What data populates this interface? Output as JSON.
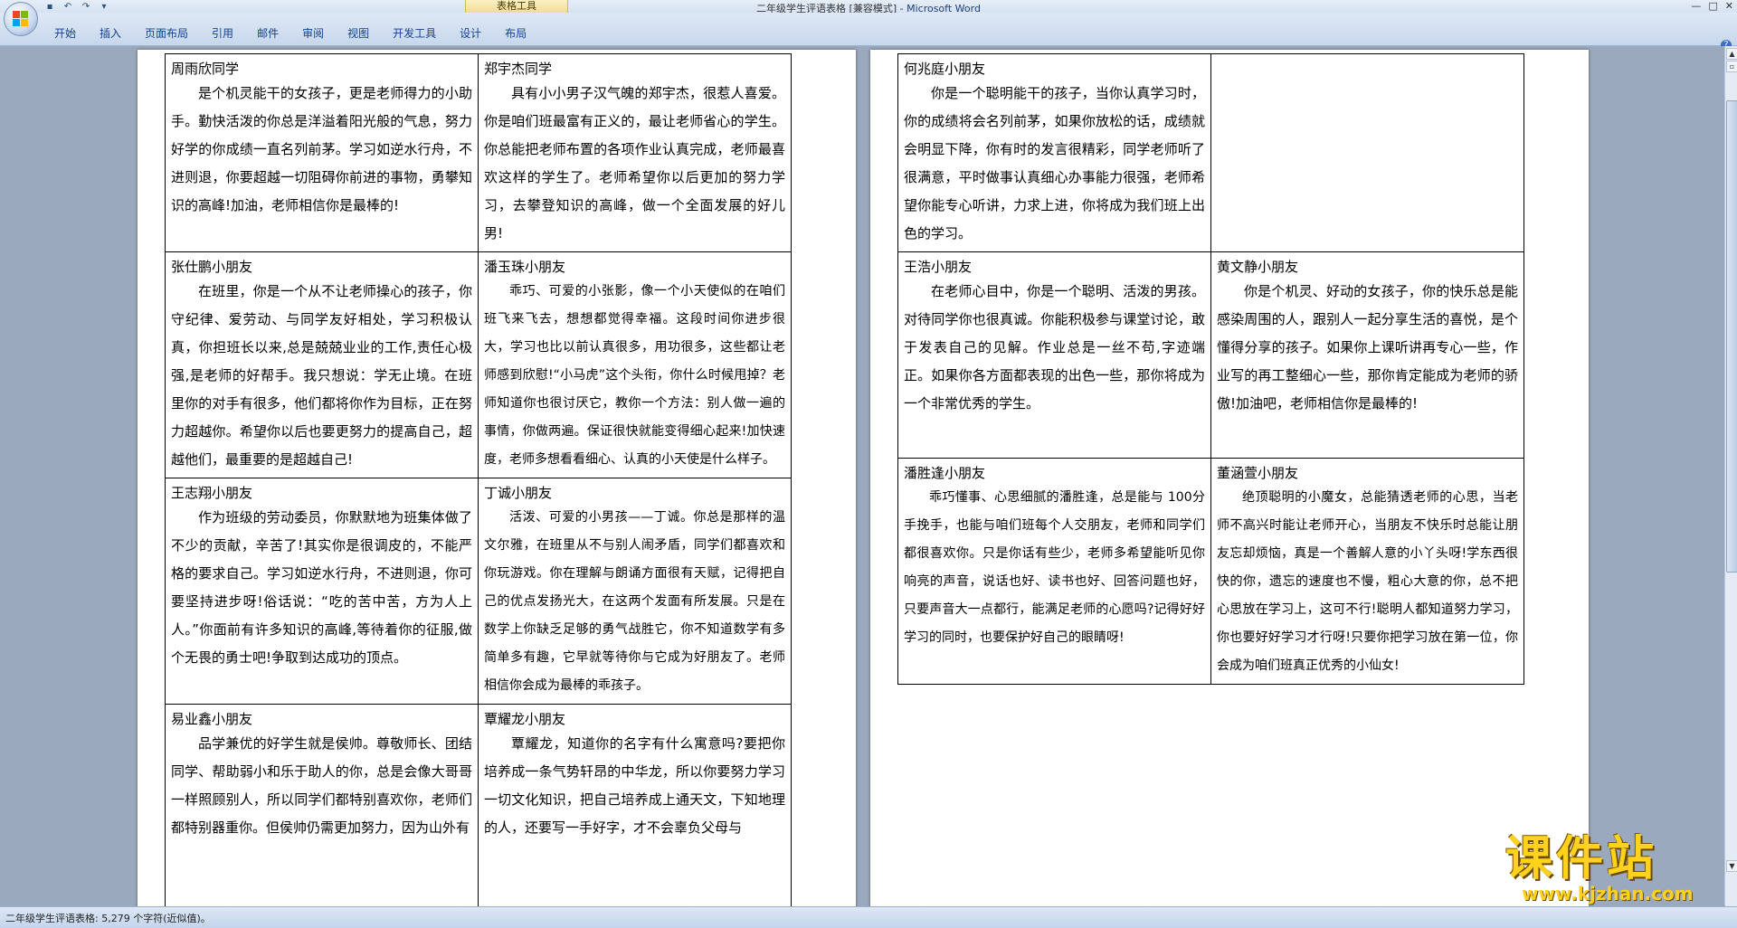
{
  "window": {
    "title": "二年级学生评语表格 [兼容模式] - ",
    "app_name": "Microsoft Word",
    "context_tab": "表格工具",
    "controls": [
      "—",
      "□",
      "✕"
    ]
  },
  "ribbon": {
    "tabs": [
      "开始",
      "插入",
      "页面布局",
      "引用",
      "邮件",
      "审阅",
      "视图",
      "开发工具",
      "设计",
      "布局"
    ],
    "help": "?"
  },
  "pages": [
    {
      "rows": [
        [
          {
            "name": "周雨欣同学",
            "text": "是个机灵能干的女孩子，更是老师得力的小助手。勤快活泼的你总是洋溢着阳光般的气息，努力好学的你成绩一直名列前茅。学习如逆水行舟，不进则退，你要超越一切阻碍你前进的事物，勇攀知识的高峰!加油，老师相信你是最棒的!"
          },
          {
            "name": "郑宇杰同学",
            "text": "具有小小男子汉气魄的郑宇杰，很惹人喜爱。你是咱们班最富有正义的，最让老师省心的学生。你总能把老师布置的各项作业认真完成，老师最喜欢这样的学生了。老师希望你以后更加的努力学习，去攀登知识的高峰，做一个全面发展的好儿男!"
          }
        ],
        [
          {
            "name": "张仕鹏小朋友",
            "text": "在班里，你是一个从不让老师操心的孩子，你守纪律、爱劳动、与同学友好相处，学习积极认真，你担班长以来,总是兢兢业业的工作,责任心极强,是老师的好帮手。我只想说：学无止境。在班里你的对手有很多，他们都将你作为目标，正在努力超越你。希望你以后也要更努力的提高自己，超越他们，最重要的是超越自己!"
          },
          {
            "name": "潘玉珠小朋友",
            "text": "乖巧、可爱的小张影，像一个小天使似的在咱们班飞来飞去，想想都觉得幸福。这段时间你进步很大，学习也比以前认真很多，用功很多，这些都让老师感到欣慰!“小马虎”这个头衔，你什么时候甩掉？老师知道你也很讨厌它，教你一个方法：别人做一遍的事情，你做两遍。保证很快就能变得细心起来!加快速度，老师多想看看细心、认真的小天使是什么样子。"
          }
        ],
        [
          {
            "name": "王志翔小朋友",
            "text": "作为班级的劳动委员，你默默地为班集体做了不少的贡献，辛苦了!其实你是很调皮的，不能严格的要求自己。学习如逆水行舟，不进则退，你可要坚持进步呀!俗话说：“吃的苦中苦，方为人上人。”你面前有许多知识的高峰,等待着你的征服,做个无畏的勇士吧!争取到达成功的顶点。"
          },
          {
            "name": "丁诚小朋友",
            "text": "活泼、可爱的小男孩——丁诚。你总是那样的温文尔雅，在班里从不与别人闹矛盾，同学们都喜欢和你玩游戏。你在理解与朗诵方面很有天赋，记得把自己的优点发扬光大，在这两个发面有所发展。只是在数学上你缺乏足够的勇气战胜它，你不知道数学有多简单多有趣，它早就等待你与它成为好朋友了。老师相信你会成为最棒的乖孩子。"
          }
        ],
        [
          {
            "name": "易业鑫小朋友",
            "text": "品学兼优的好学生就是侯帅。尊敬师长、团结同学、帮助弱小和乐于助人的你，总是会像大哥哥一样照顾别人，所以同学们都特别喜欢你，老师们都特别器重你。但侯帅仍需更加努力，因为山外有"
          },
          {
            "name": "覃耀龙小朋友",
            "text": "覃耀龙，知道你的名字有什么寓意吗?要把你培养成一条气势轩昂的中华龙，所以你要努力学习一切文化知识，把自己培养成上通天文，下知地理的人，还要写一手好字，才不会辜负父母与"
          }
        ]
      ]
    },
    {
      "rows": [
        [
          {
            "name": "何兆庭小朋友",
            "text": "你是一个聪明能干的孩子，当你认真学习时，你的成绩将会名列前茅，如果你放松的话，成绩就会明显下降，你有时的发言很精彩，同学老师听了很满意，平时做事认真细心办事能力很强，老师希望你能专心听讲，力求上进，你将成为我们班上出色的学习。"
          },
          {
            "name": "",
            "text": ""
          }
        ],
        [
          {
            "name": "王浩小朋友",
            "text": "在老师心目中，你是一个聪明、活泼的男孩。对待同学你也很真诚。你能积极参与课堂讨论，敢于发表自己的见解。作业总是一丝不苟,字迹端正。如果你各方面都表现的出色一些，那你将成为一个非常优秀的学生。"
          },
          {
            "name": "黄文静小朋友",
            "text": "你是个机灵、好动的女孩子，你的快乐总是能感染周围的人，跟别人一起分享生活的喜悦，是个懂得分享的孩子。如果你上课听讲再专心一些，作业写的再工整细心一些，那你肯定能成为老师的骄傲!加油吧，老师相信你是最棒的!"
          }
        ],
        [
          {
            "name": "潘胜逢小朋友",
            "text": "乖巧懂事、心思细腻的潘胜逢，总是能与 100分手挽手，也能与咱们班每个人交朋友，老师和同学们都很喜欢你。只是你话有些少，老师多希望能听见你响亮的声音，说话也好、读书也好、回答问题也好，只要声音大一点都行，能满足老师的心愿吗?记得好好学习的同时，也要保护好自己的眼睛呀!"
          },
          {
            "name": "董涵萱小朋友",
            "text": "绝顶聪明的小魔女，总能猜透老师的心思，当老师不高兴时能让老师开心，当朋友不快乐时总能让朋友忘却烦恼，真是一个善解人意的小丫头呀!学东西很快的你，遗忘的速度也不慢，粗心大意的你，总不把心思放在学习上，这可不行!聪明人都知道努力学习，你也要好好学习才行呀!只要你把学习放在第一位，你会成为咱们班真正优秀的小仙女!"
          }
        ]
      ]
    }
  ],
  "status": {
    "text": "二年级学生评语表格: 5,279 个字符(近似值)。"
  },
  "watermark": {
    "main": "课件站",
    "url": "www.kjzhan.com"
  }
}
